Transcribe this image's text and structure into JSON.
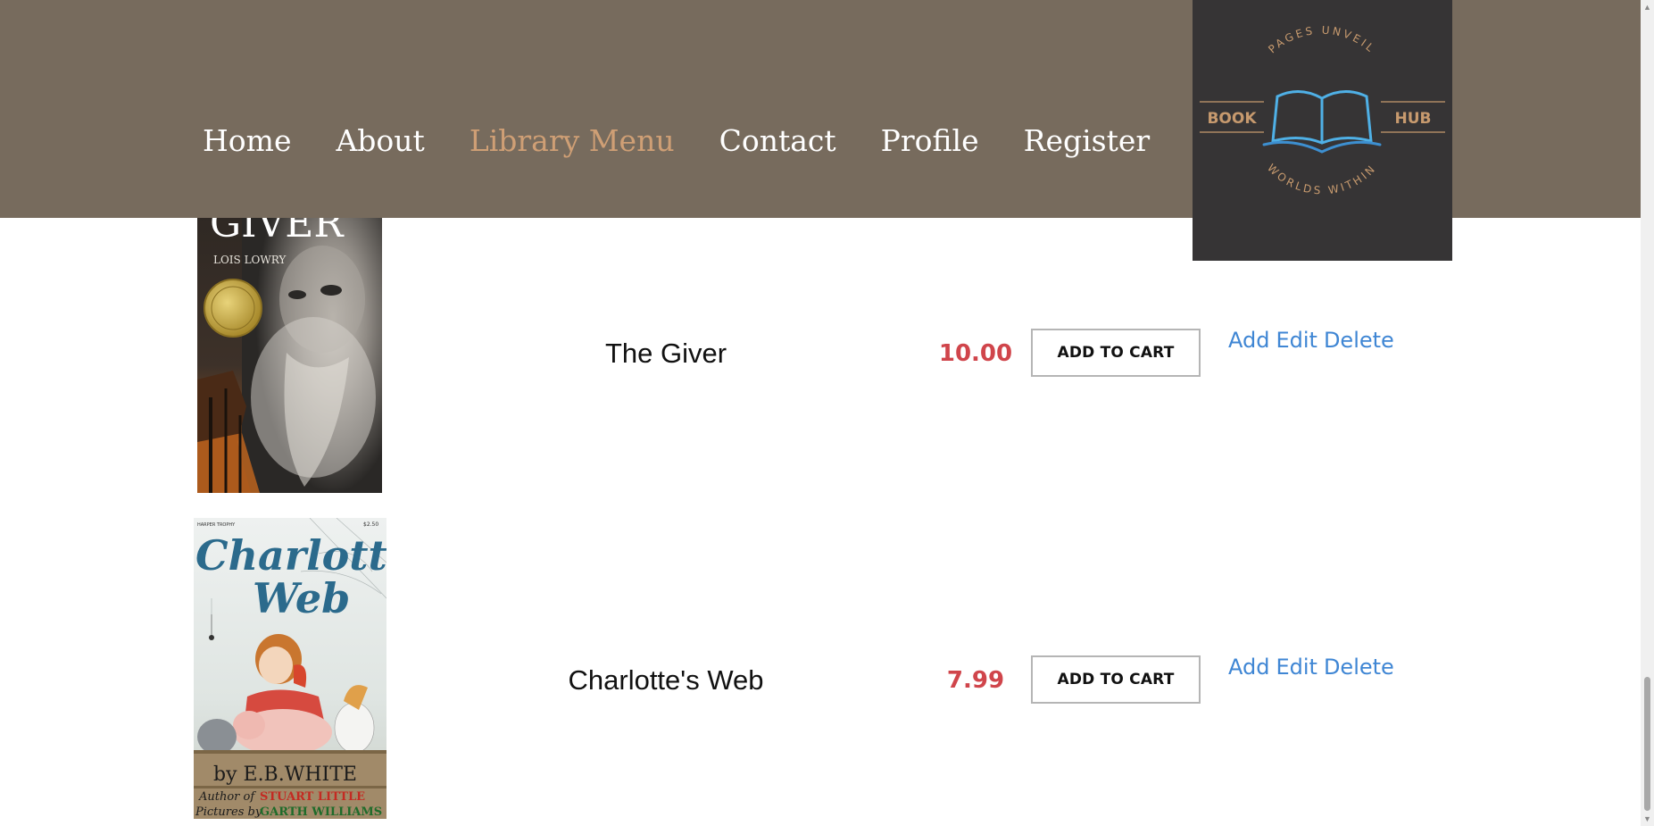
{
  "header": {
    "nav": [
      {
        "label": "Home",
        "active": false
      },
      {
        "label": "About",
        "active": false
      },
      {
        "label": "Library Menu",
        "active": true
      },
      {
        "label": "Contact",
        "active": false
      },
      {
        "label": "Profile",
        "active": false
      },
      {
        "label": "Register",
        "active": false
      }
    ],
    "logo": {
      "top_text": "PAGES UNVEIL",
      "left_text": "BOOK",
      "right_text": "HUB",
      "bottom_text": "WORLDS WITHIN"
    }
  },
  "books": [
    {
      "title": "The Giver",
      "price": "10.00",
      "cart_label": "ADD TO CART",
      "cover": {
        "title": "GIVER",
        "author": "LOIS LOWRY"
      },
      "actions": [
        "Add",
        "Edit",
        "Delete"
      ]
    },
    {
      "title": "Charlotte's Web",
      "price": "7.99",
      "cart_label": "ADD TO CART",
      "cover": {
        "publisher": "HARPER TROPHY",
        "price_tag": "$2.50",
        "title_line1": "Charlotte's",
        "title_line2": "Web",
        "author": "by E.B.WHITE",
        "author_of_prefix": "Author of",
        "author_of_title": "STUART LITTLE",
        "pictures_prefix": "Pictures by",
        "illustrator": "GARTH WILLIAMS"
      },
      "actions": [
        "Add",
        "Edit",
        "Delete"
      ]
    }
  ],
  "colors": {
    "header_bg": "#776b5d",
    "nav_active": "#cf9f75",
    "logo_bg": "#363435",
    "price": "#d0454b",
    "action_link": "#3f86d4"
  }
}
